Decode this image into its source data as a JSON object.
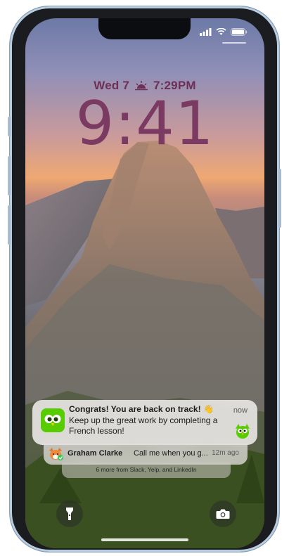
{
  "status_bar": {
    "icons": [
      "signal-icon",
      "wifi-icon",
      "battery-icon"
    ]
  },
  "lock_screen": {
    "date": "Wed 7",
    "widget_icon": "sunset-icon",
    "widget_time": "7:29PM",
    "time": "9:41",
    "text_color": "#7a3a62"
  },
  "notifications": {
    "primary": {
      "app_icon": "duolingo-owl-icon",
      "title": "Congrats! You are back on track! 👋",
      "body": "Keep up the great work by completing a French lesson!",
      "time": "now"
    },
    "secondary": {
      "sender": "Graham Clarke",
      "message": "Call me when you g...",
      "time": "12m ago"
    },
    "more": "6 more from Slack, Yelp, and LinkedIn"
  },
  "quick_actions": {
    "left": "flashlight-icon",
    "right": "camera-icon"
  }
}
